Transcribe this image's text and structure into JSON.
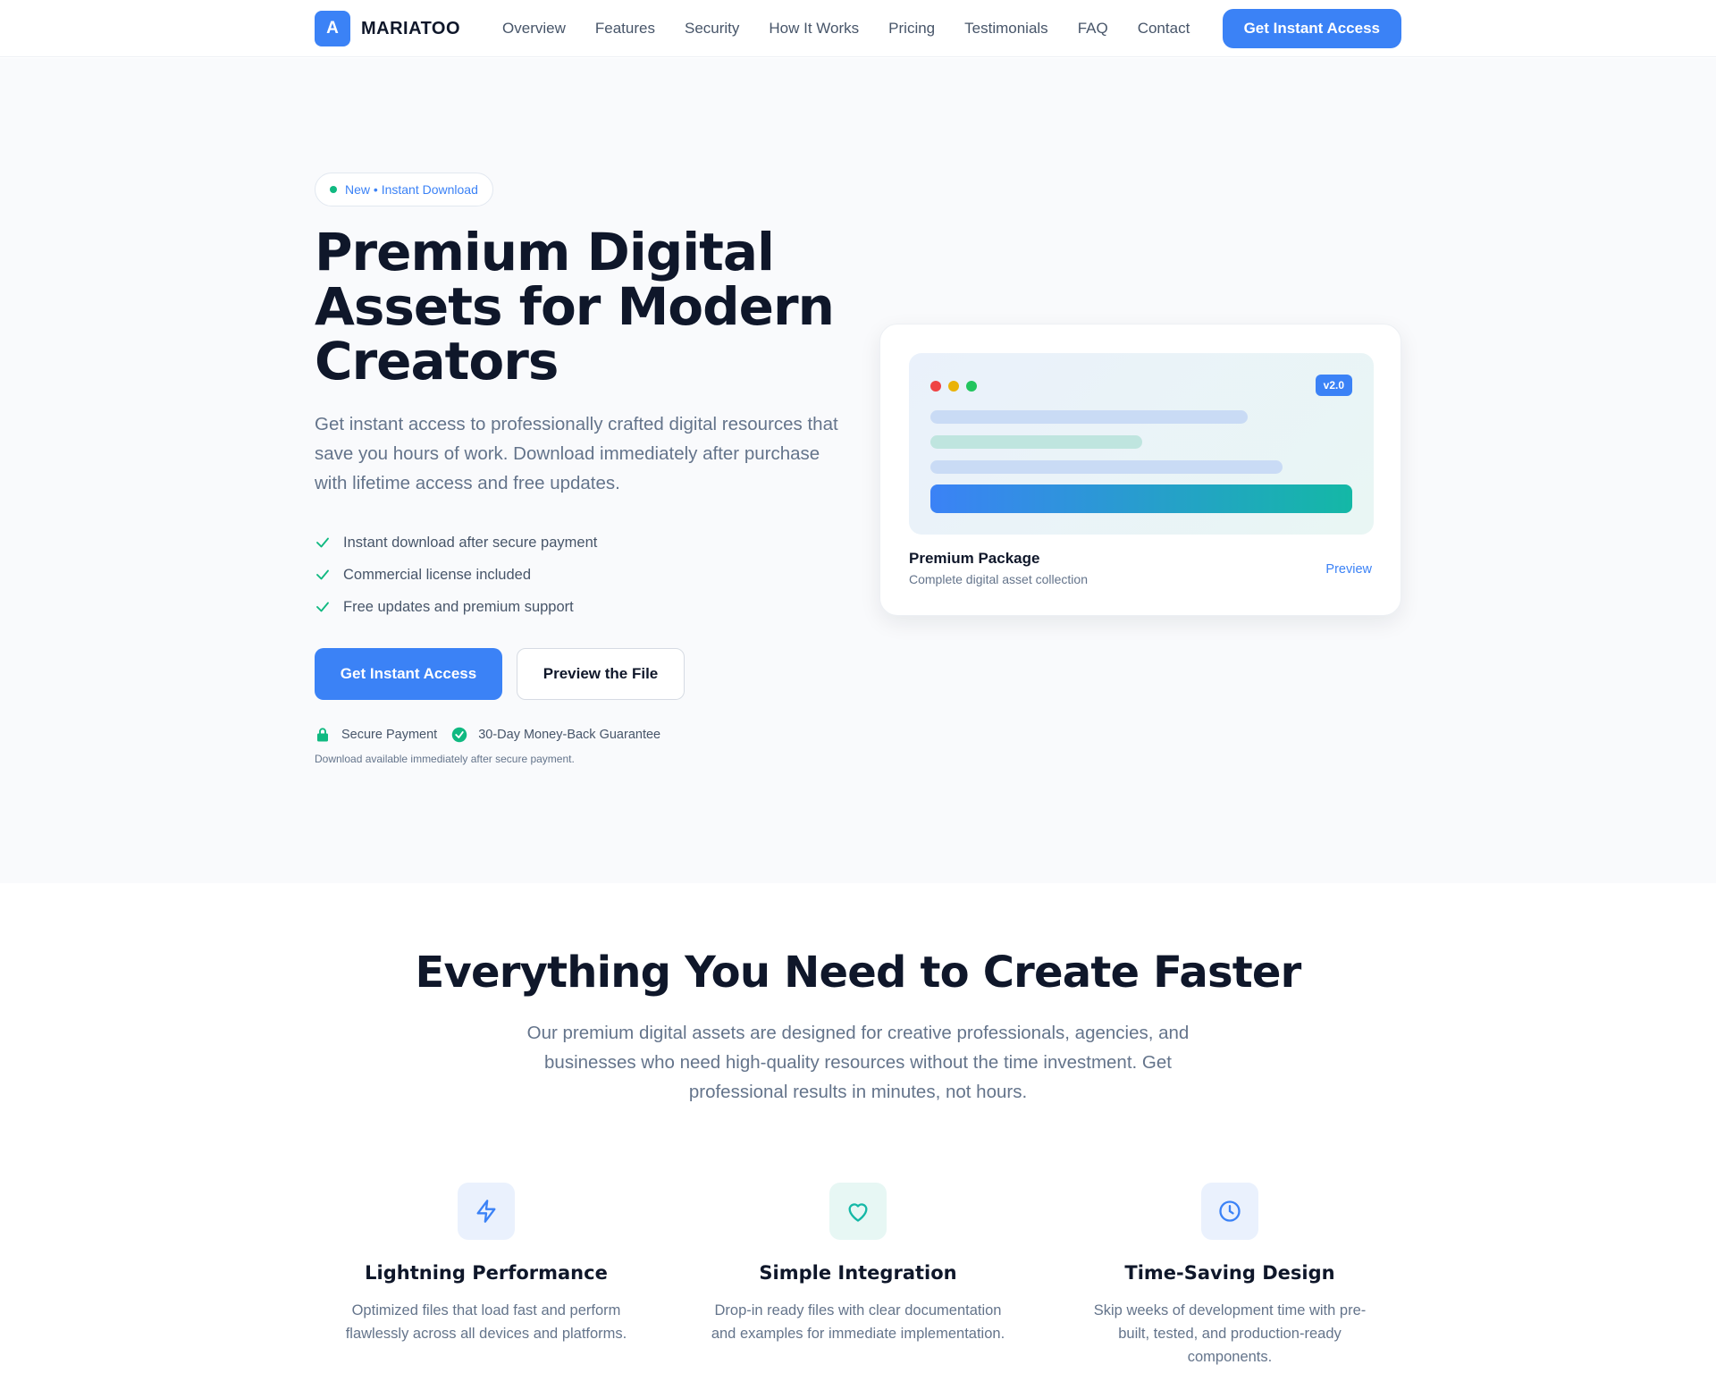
{
  "nav": {
    "logo_letter": "A",
    "brand": "MARIATOO",
    "links": [
      "Overview",
      "Features",
      "Security",
      "How It Works",
      "Pricing",
      "Testimonials",
      "FAQ",
      "Contact"
    ],
    "cta": "Get Instant Access"
  },
  "hero": {
    "badge": "New • Instant Download",
    "title": "Premium Digital Assets for Modern Creators",
    "subtitle": "Get instant access to professionally crafted digital resources that save you hours of work. Download immediately after purchase with lifetime access and free updates.",
    "checks": [
      "Instant download after secure payment",
      "Commercial license included",
      "Free updates and premium support"
    ],
    "primary_button": "Get Instant Access",
    "secondary_button": "Preview the File",
    "trust_secure": "Secure Payment",
    "trust_guarantee": "30-Day Money-Back Guarantee",
    "trust_note": "Download available immediately after secure payment."
  },
  "preview_card": {
    "version": "v2.0",
    "title": "Premium Package",
    "description": "Complete digital asset collection",
    "link": "Preview"
  },
  "features": {
    "title": "Everything You Need to Create Faster",
    "subtitle": "Our premium digital assets are designed for creative professionals, agencies, and businesses who need high-quality resources without the time investment. Get professional results in minutes, not hours.",
    "items": [
      {
        "icon": "lightning-icon",
        "title": "Lightning Performance",
        "description": "Optimized files that load fast and perform flawlessly across all devices and platforms."
      },
      {
        "icon": "heart-icon",
        "title": "Simple Integration",
        "description": "Drop-in ready files with clear documentation and examples for immediate implementation."
      },
      {
        "icon": "clock-icon",
        "title": "Time-Saving Design",
        "description": "Skip weeks of development time with pre-built, tested, and production-ready components."
      }
    ]
  },
  "colors": {
    "primary": "#3b82f6",
    "accent": "#10b981",
    "heading": "#0f172a",
    "muted": "#64748b"
  }
}
